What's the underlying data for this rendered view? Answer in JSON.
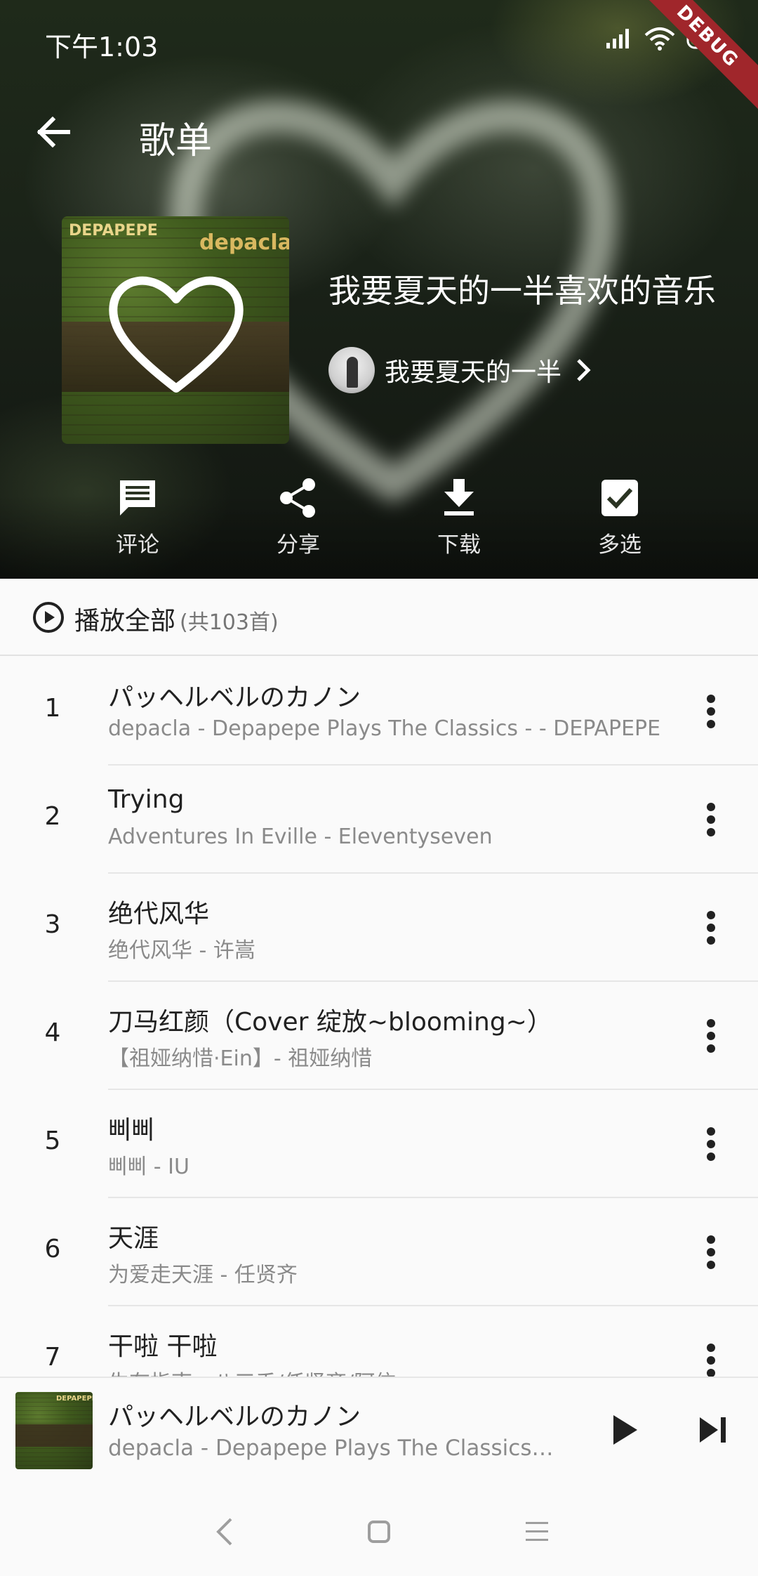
{
  "status_bar": {
    "time": "下午1:03",
    "debug_label": "DEBUG"
  },
  "app_bar": {
    "title": "歌单",
    "back_icon": "arrow-left-icon"
  },
  "playlist": {
    "title": "我要夏天的一半喜欢的音乐",
    "cover": {
      "brand": "DEPAPEPE",
      "title": "depacla"
    },
    "creator": {
      "name": "我要夏天的一半"
    }
  },
  "actions": [
    {
      "label": "评论",
      "icon": "comment-icon"
    },
    {
      "label": "分享",
      "icon": "share-icon"
    },
    {
      "label": "下载",
      "icon": "download-icon"
    },
    {
      "label": "多选",
      "icon": "check-box-icon"
    }
  ],
  "play_all": {
    "label": "播放全部",
    "count": "(共103首)"
  },
  "songs": [
    {
      "index": "1",
      "title": "パッヘルベルのカノン",
      "subtitle": "depacla - Depapepe Plays The Classics - - DEPAPEPE"
    },
    {
      "index": "2",
      "title": "Trying",
      "subtitle": "Adventures In Eville - Eleventyseven"
    },
    {
      "index": "3",
      "title": "绝代风华",
      "subtitle": "绝代风华 - 许嵩"
    },
    {
      "index": "4",
      "title": "刀马红颜（Cover 绽放~blooming~）",
      "subtitle": "【祖娅纳惜·Ein】- 祖娅纳惜"
    },
    {
      "index": "5",
      "title": "삐삐",
      "subtitle": "삐삐 - IU"
    },
    {
      "index": "6",
      "title": "天涯",
      "subtitle": "为爱走天涯 - 任贤齐"
    },
    {
      "index": "7",
      "title": "干啦 干啦",
      "subtitle": "生存指南 - 八三夭/任贤齐/阿信"
    }
  ],
  "mini_player": {
    "title": "パッヘルベルのカノン",
    "subtitle": "depacla - Depapepe Plays The Classics - - DEPAPEPE"
  },
  "colors": {
    "header_dark": "#1a2218",
    "list_bg": "#fafafa",
    "secondary_text": "#8a8a8a",
    "debug_ribbon": "#a0262b"
  }
}
